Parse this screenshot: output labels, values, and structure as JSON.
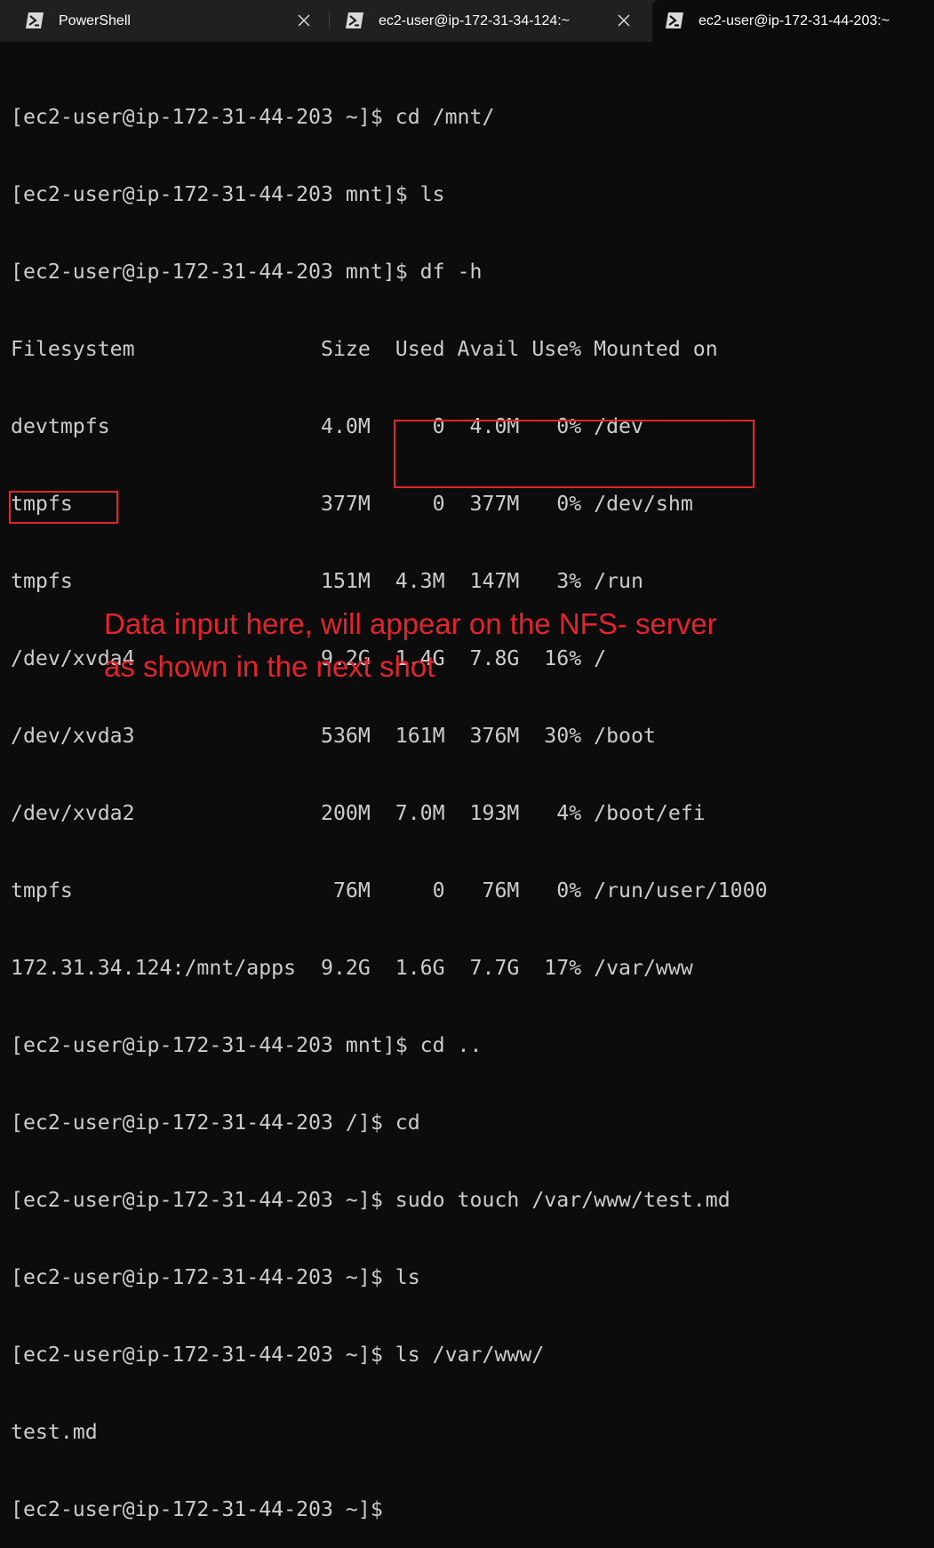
{
  "tabs": [
    {
      "label": "PowerShell",
      "icon": "powershell-icon",
      "closable": true,
      "active": false
    },
    {
      "label": "ec2-user@ip-172-31-34-124:~",
      "icon": "powershell-icon",
      "closable": true,
      "active": false
    },
    {
      "label": "ec2-user@ip-172-31-44-203:~",
      "icon": "powershell-icon",
      "closable": false,
      "active": true
    }
  ],
  "terminal": {
    "lines": [
      "[ec2-user@ip-172-31-44-203 ~]$ cd /mnt/",
      "[ec2-user@ip-172-31-44-203 mnt]$ ls",
      "[ec2-user@ip-172-31-44-203 mnt]$ df -h",
      "Filesystem               Size  Used Avail Use% Mounted on",
      "devtmpfs                 4.0M     0  4.0M   0% /dev",
      "tmpfs                    377M     0  377M   0% /dev/shm",
      "tmpfs                    151M  4.3M  147M   3% /run",
      "/dev/xvda4               9.2G  1.4G  7.8G  16% /",
      "/dev/xvda3               536M  161M  376M  30% /boot",
      "/dev/xvda2               200M  7.0M  193M   4% /boot/efi",
      "tmpfs                     76M     0   76M   0% /run/user/1000",
      "172.31.34.124:/mnt/apps  9.2G  1.6G  7.7G  17% /var/www",
      "[ec2-user@ip-172-31-44-203 mnt]$ cd ..",
      "[ec2-user@ip-172-31-44-203 /]$ cd",
      "[ec2-user@ip-172-31-44-203 ~]$ sudo touch /var/www/test.md",
      "[ec2-user@ip-172-31-44-203 ~]$ ls",
      "[ec2-user@ip-172-31-44-203 ~]$ ls /var/www/",
      "test.md",
      "[ec2-user@ip-172-31-44-203 ~]$"
    ]
  },
  "annotation": {
    "line1": "Data input here, will appear on the NFS- server",
    "line2": "as shown in the next shot"
  },
  "colors": {
    "background": "#0c0c0c",
    "tabbar": "#202020",
    "text": "#cccccc",
    "highlight": "#e2242c"
  }
}
